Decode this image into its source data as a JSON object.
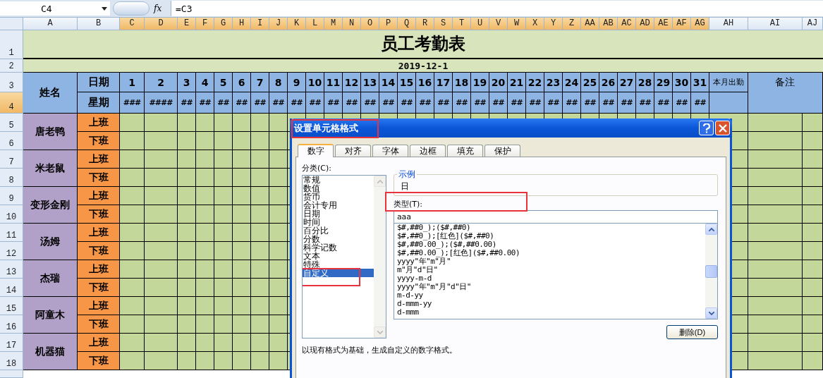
{
  "formula_bar": {
    "name_box": "C4",
    "fx": "fx",
    "formula": "=C3"
  },
  "columns": [
    {
      "label": "A",
      "selected": false
    },
    {
      "label": "B",
      "selected": false
    },
    {
      "label": "C",
      "selected": true
    },
    {
      "label": "D",
      "selected": true
    },
    {
      "label": "E",
      "selected": true
    },
    {
      "label": "F",
      "selected": true
    },
    {
      "label": "G",
      "selected": true
    },
    {
      "label": "H",
      "selected": true
    },
    {
      "label": "I",
      "selected": true
    },
    {
      "label": "J",
      "selected": true
    },
    {
      "label": "K",
      "selected": true
    },
    {
      "label": "L",
      "selected": true
    },
    {
      "label": "M",
      "selected": true
    },
    {
      "label": "N",
      "selected": true
    },
    {
      "label": "O",
      "selected": true
    },
    {
      "label": "P",
      "selected": true
    },
    {
      "label": "Q",
      "selected": true
    },
    {
      "label": "R",
      "selected": true
    },
    {
      "label": "S",
      "selected": true
    },
    {
      "label": "T",
      "selected": true
    },
    {
      "label": "U",
      "selected": true
    },
    {
      "label": "V",
      "selected": true
    },
    {
      "label": "W",
      "selected": true
    },
    {
      "label": "X",
      "selected": true
    },
    {
      "label": "Y",
      "selected": true
    },
    {
      "label": "Z",
      "selected": true
    },
    {
      "label": "AA",
      "selected": true
    },
    {
      "label": "AB",
      "selected": true
    },
    {
      "label": "AC",
      "selected": true
    },
    {
      "label": "AD",
      "selected": true
    },
    {
      "label": "AE",
      "selected": true
    },
    {
      "label": "AF",
      "selected": true
    },
    {
      "label": "AG",
      "selected": true
    },
    {
      "label": "AH",
      "selected": false
    },
    {
      "label": "AI",
      "selected": false
    },
    {
      "label": "AJ",
      "selected": false
    }
  ],
  "rows": [
    {
      "label": "1",
      "selected": false
    },
    {
      "label": "2",
      "selected": false
    },
    {
      "label": "3",
      "selected": false
    },
    {
      "label": "4",
      "selected": true
    },
    {
      "label": "5",
      "selected": false
    },
    {
      "label": "6",
      "selected": false
    },
    {
      "label": "7",
      "selected": false
    },
    {
      "label": "8",
      "selected": false
    },
    {
      "label": "9",
      "selected": false
    },
    {
      "label": "10",
      "selected": false
    },
    {
      "label": "11",
      "selected": false
    },
    {
      "label": "12",
      "selected": false
    },
    {
      "label": "13",
      "selected": false
    },
    {
      "label": "14",
      "selected": false
    },
    {
      "label": "15",
      "selected": false
    },
    {
      "label": "16",
      "selected": false
    },
    {
      "label": "17",
      "selected": false
    },
    {
      "label": "18",
      "selected": false
    }
  ],
  "sheet": {
    "title": "员工考勤表",
    "date": "2019-12-1",
    "name_header": "姓名",
    "date_header": "日期",
    "weekday_header": "星期",
    "total_header": "本月出勤",
    "notes_header": "备注",
    "days": [
      "1",
      "2",
      "3",
      "4",
      "5",
      "6",
      "7",
      "8",
      "9",
      "10",
      "11",
      "12",
      "13",
      "14",
      "15",
      "16",
      "17",
      "18",
      "19",
      "20",
      "21",
      "22",
      "23",
      "24",
      "25",
      "26",
      "27",
      "28",
      "29",
      "30",
      "31"
    ],
    "weekdays": [
      "###",
      "####",
      "##",
      "##",
      "##",
      "##",
      "##",
      "##",
      "##",
      "##",
      "##",
      "##",
      "##",
      "##",
      "##",
      "##",
      "##",
      "##",
      "##",
      "##",
      "##",
      "##",
      "##",
      "##",
      "##",
      "##",
      "##",
      "##",
      "##",
      "##",
      "##"
    ],
    "employees": [
      {
        "name": "唐老鸭",
        "shifts": [
          "上班",
          "下班"
        ]
      },
      {
        "name": "米老鼠",
        "shifts": [
          "上班",
          "下班"
        ]
      },
      {
        "name": "变形金刚",
        "shifts": [
          "上班",
          "下班"
        ]
      },
      {
        "name": "汤姆",
        "shifts": [
          "上班",
          "下班"
        ]
      },
      {
        "name": "杰瑞",
        "shifts": [
          "上班",
          "下班"
        ]
      },
      {
        "name": "阿童木",
        "shifts": [
          "上班",
          "下班"
        ]
      },
      {
        "name": "机器猫",
        "shifts": [
          "上班",
          "下班"
        ]
      }
    ]
  },
  "dialog": {
    "title": "设置单元格格式",
    "title_highlighted": true,
    "tabs": [
      {
        "label": "数字",
        "selected": true
      },
      {
        "label": "对齐",
        "selected": false
      },
      {
        "label": "字体",
        "selected": false
      },
      {
        "label": "边框",
        "selected": false
      },
      {
        "label": "填充",
        "selected": false
      },
      {
        "label": "保护",
        "selected": false
      }
    ],
    "category_label": "分类(C):",
    "categories": [
      {
        "label": "常规",
        "selected": false,
        "highlighted": false
      },
      {
        "label": "数值",
        "selected": false,
        "highlighted": false
      },
      {
        "label": "货币",
        "selected": false,
        "highlighted": false
      },
      {
        "label": "会计专用",
        "selected": false,
        "highlighted": false
      },
      {
        "label": "日期",
        "selected": false,
        "highlighted": false
      },
      {
        "label": "时间",
        "selected": false,
        "highlighted": false
      },
      {
        "label": "百分比",
        "selected": false,
        "highlighted": false
      },
      {
        "label": "分数",
        "selected": false,
        "highlighted": false
      },
      {
        "label": "科学记数",
        "selected": false,
        "highlighted": false
      },
      {
        "label": "文本",
        "selected": false,
        "highlighted": false
      },
      {
        "label": "特殊",
        "selected": false,
        "highlighted": false
      },
      {
        "label": "自定义",
        "selected": true,
        "highlighted": true
      }
    ],
    "sample_label": "示例",
    "sample_value": "日",
    "type_label": "类型(T):",
    "type_highlighted": true,
    "type_value": "aaa",
    "formats": [
      "$#,##0_);($#,##0)",
      "$#,##0_);[红色]($#,##0)",
      "$#,##0.00_);($#,##0.00)",
      "$#,##0.00_);[红色]($#,##0.00)",
      "yyyy\"年\"m\"月\"",
      "m\"月\"d\"日\"",
      "yyyy-m-d",
      "yyyy\"年\"m\"月\"d\"日\"",
      "m-d-yy",
      "d-mmm-yy",
      "d-mmm"
    ],
    "delete_button": "删除(D)",
    "description": "以现有格式为基础，生成自定义的数字格式。"
  }
}
